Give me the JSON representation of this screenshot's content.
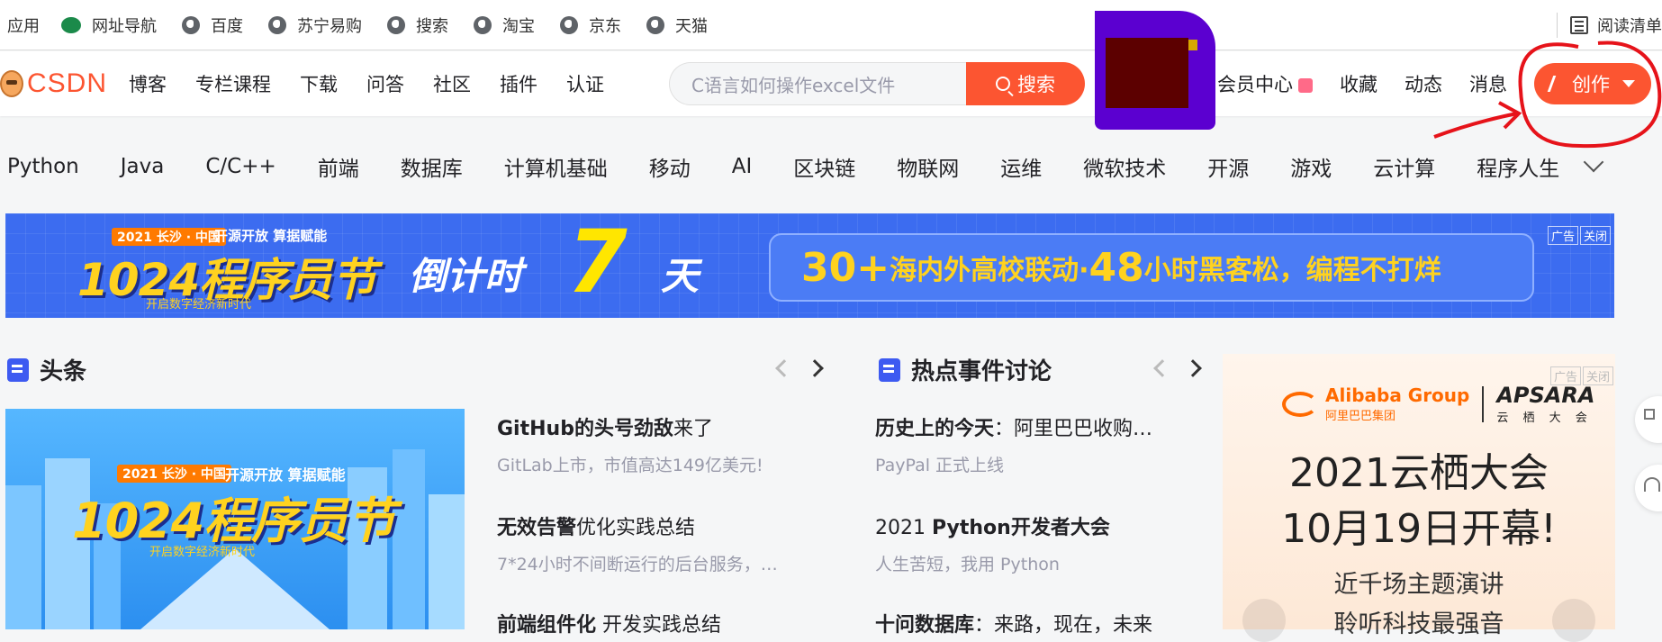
{
  "bookmarks": {
    "apps": "应用",
    "items": [
      "网址导航",
      "百度",
      "苏宁易购",
      "搜索",
      "淘宝",
      "京东",
      "天猫"
    ],
    "reading_list": "阅读清单"
  },
  "toolbar": {
    "logo": "CSDN",
    "nav": [
      "博客",
      "专栏课程",
      "下载",
      "问答",
      "社区",
      "插件",
      "认证"
    ],
    "search_placeholder": "C语言如何操作excel文件",
    "search_button": "搜索",
    "right_links": [
      "会员中心",
      "收藏",
      "动态",
      "消息"
    ],
    "create_button": "创作"
  },
  "categories": [
    "Python",
    "Java",
    "C/C++",
    "前端",
    "数据库",
    "计算机基础",
    "移动",
    "AI",
    "区块链",
    "物联网",
    "运维",
    "微软技术",
    "开源",
    "游戏",
    "云计算",
    "程序人生"
  ],
  "banner": {
    "event_small_left": "2021 长沙 · 中国",
    "event_small_right": "开源开放 算据赋能",
    "event_title": "1024程序员节",
    "event_sub": "开启数字经济新时代",
    "countdown_pre": "倒计时",
    "countdown_num": "7",
    "countdown_post": "天",
    "pill_big1": "30+",
    "pill_text1": "海内外高校联动·",
    "pill_big2": "48",
    "pill_text2": "小时黑客松，编程不打烊",
    "ad": "广告",
    "close": "关闭"
  },
  "headlines": {
    "title": "头条",
    "hero_small_left": "2021 长沙 · 中国",
    "hero_small_right": "开源开放 算据赋能",
    "hero_title": "1024程序员节",
    "hero_sub": "开启数字经济新时代",
    "articles": [
      {
        "title_bold": "GitHub的头号劲敌",
        "title_rest": "来了",
        "desc": "GitLab上市，市值高达149亿美元!"
      },
      {
        "title_bold": "无效告警",
        "title_rest": "优化实践总结",
        "desc": "7*24小时不间断运行的后台服务，…"
      },
      {
        "title_bold": "前端组件化",
        "title_rest": " 开发实践总结",
        "desc": ""
      }
    ]
  },
  "hot": {
    "title": "热点事件讨论",
    "articles": [
      {
        "title_bold": "历史上的今天",
        "title_rest": "：阿里巴巴收购…",
        "desc": "PayPal 正式上线"
      },
      {
        "title_pre": "2021 ",
        "title_bold": "Python开发者大会",
        "title_rest": "",
        "desc": "人生苦短，我用 Python"
      },
      {
        "title_bold": "十问数据库",
        "title_rest": "：来路，现在，未来",
        "desc": ""
      }
    ]
  },
  "side_ad": {
    "tag_ad": "广告",
    "tag_close": "关闭",
    "alibaba": "Alibaba Group",
    "alibaba_cn": "阿里巴巴集团",
    "apsara": "APSARA",
    "apsara_cn": "云 栖 大 会",
    "headline1": "2021云栖大会",
    "headline2": "10月19日开幕!",
    "line1": "近千场主题演讲",
    "line2": "聆听科技最强音"
  },
  "colors": {
    "brand": "#fc5531",
    "banner": "#3c6cf0",
    "accent_yellow": "#ffd21f"
  }
}
